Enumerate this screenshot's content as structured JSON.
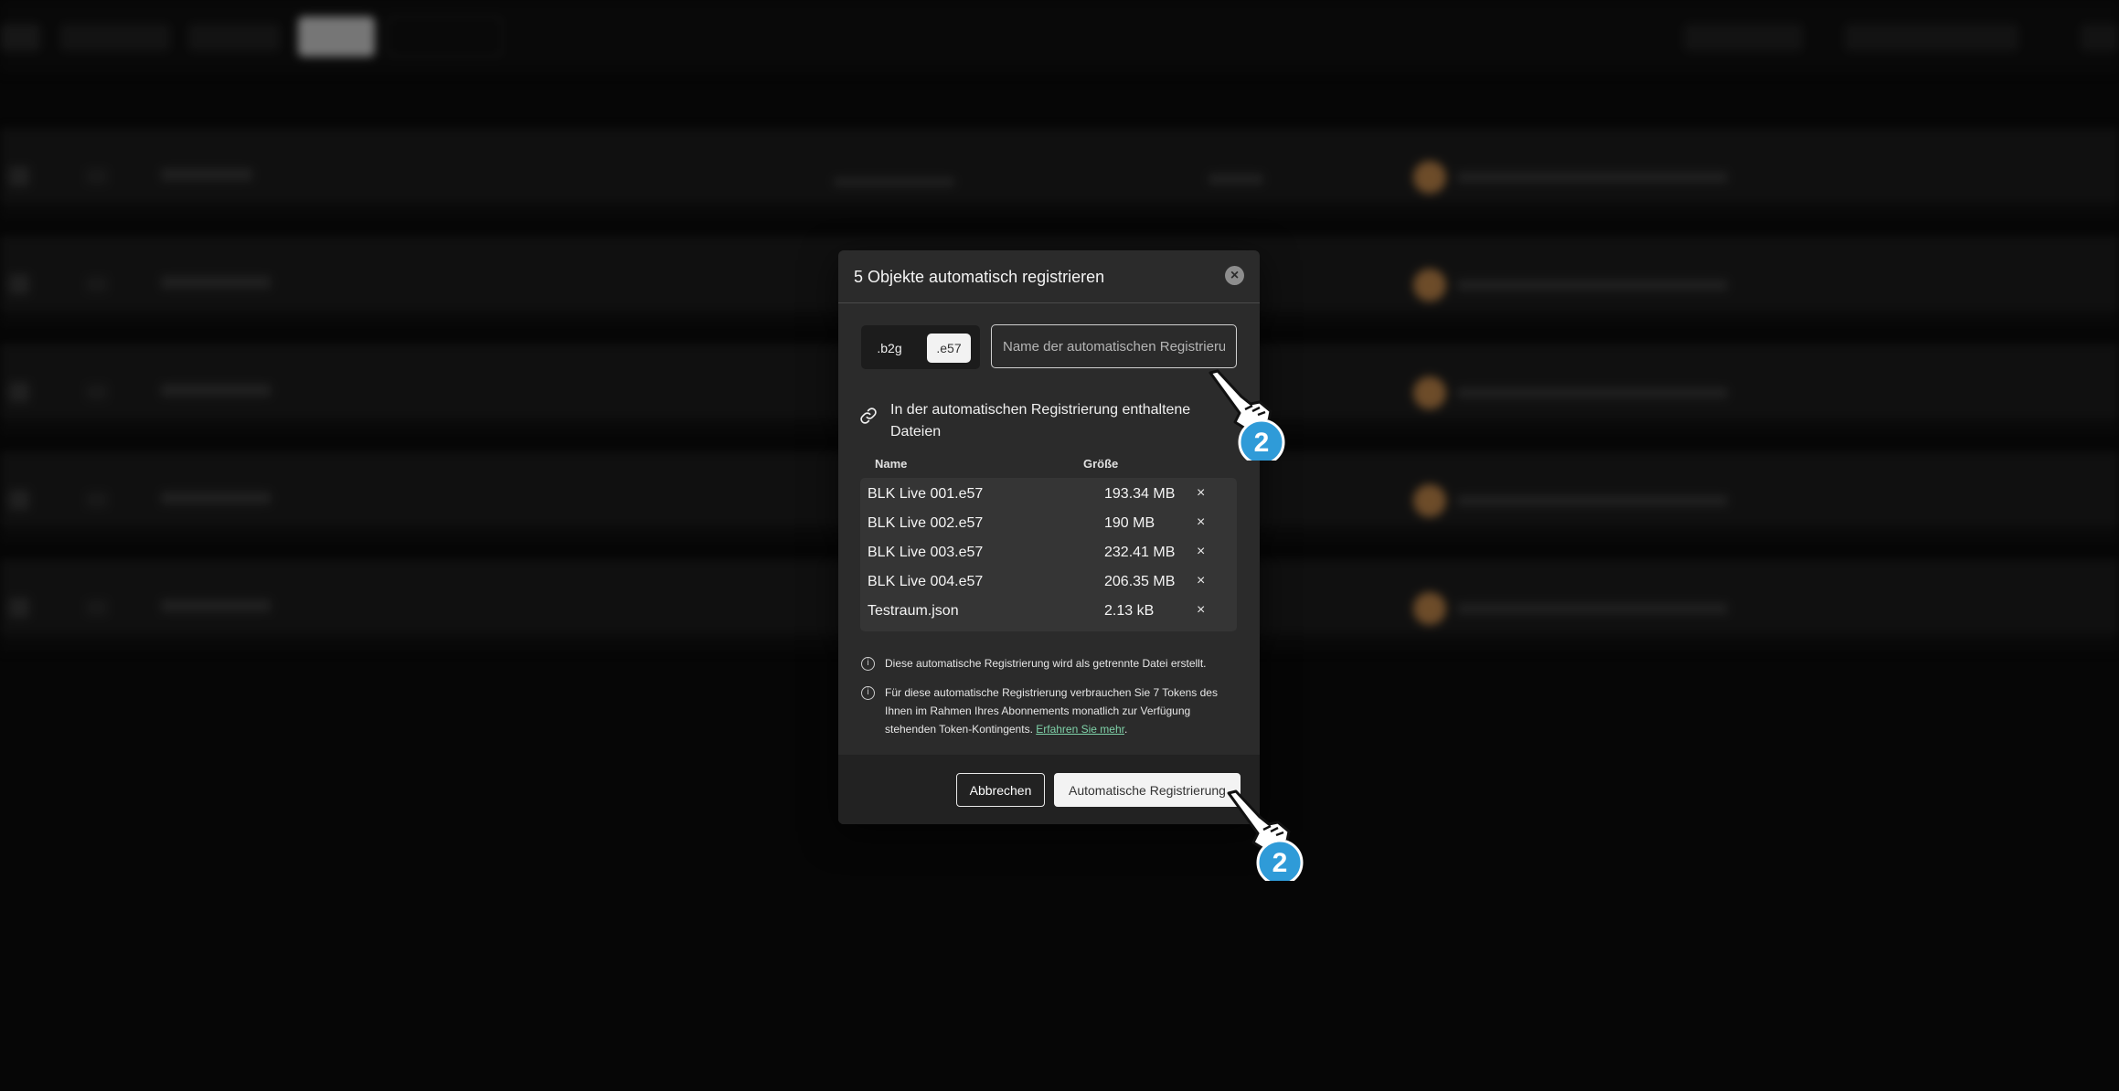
{
  "dialog": {
    "title": "5 Objekte automatisch registrieren",
    "type_options": [
      ".b2g",
      ".e57"
    ],
    "selected_type": ".e57",
    "name_placeholder": "Name der automatischen Registrierung",
    "section_title": "In der automatischen Registrierung enthaltene Dateien",
    "columns": {
      "name": "Name",
      "size": "Größe"
    },
    "files": [
      {
        "name": "BLK Live 001.e57",
        "size": "193.34 MB"
      },
      {
        "name": "BLK Live 002.e57",
        "size": "190 MB"
      },
      {
        "name": "BLK Live 003.e57",
        "size": "232.41 MB"
      },
      {
        "name": "BLK Live 004.e57",
        "size": "206.35 MB"
      },
      {
        "name": "Testraum.json",
        "size": "2.13 kB"
      }
    ],
    "remove_glyph": "×",
    "info_1": "Diese automatische Registrierung wird als getrennte Datei erstellt.",
    "info_2": "Für diese automatische Registrierung verbrauchen Sie 7 Tokens des Ihnen im Rahmen Ihres Abonnements monatlich zur Verfügung stehenden Token-Kontingents.",
    "info_2_link": "Erfahren Sie mehr",
    "info_2_end": ".",
    "cancel_label": "Abbrechen",
    "confirm_label": "Automatische Registrierung"
  },
  "markers": [
    {
      "step": "2",
      "icon": "pointing-hand-icon"
    },
    {
      "step": "2",
      "icon": "pointing-hand-icon"
    }
  ],
  "colors": {
    "dialog_bg": "#2b2b2b",
    "footer_bg": "#222222",
    "table_bg": "#353535",
    "link": "#7fd1a8",
    "marker_blue": "#2f9bd8",
    "avatar": "#c68a4c"
  }
}
